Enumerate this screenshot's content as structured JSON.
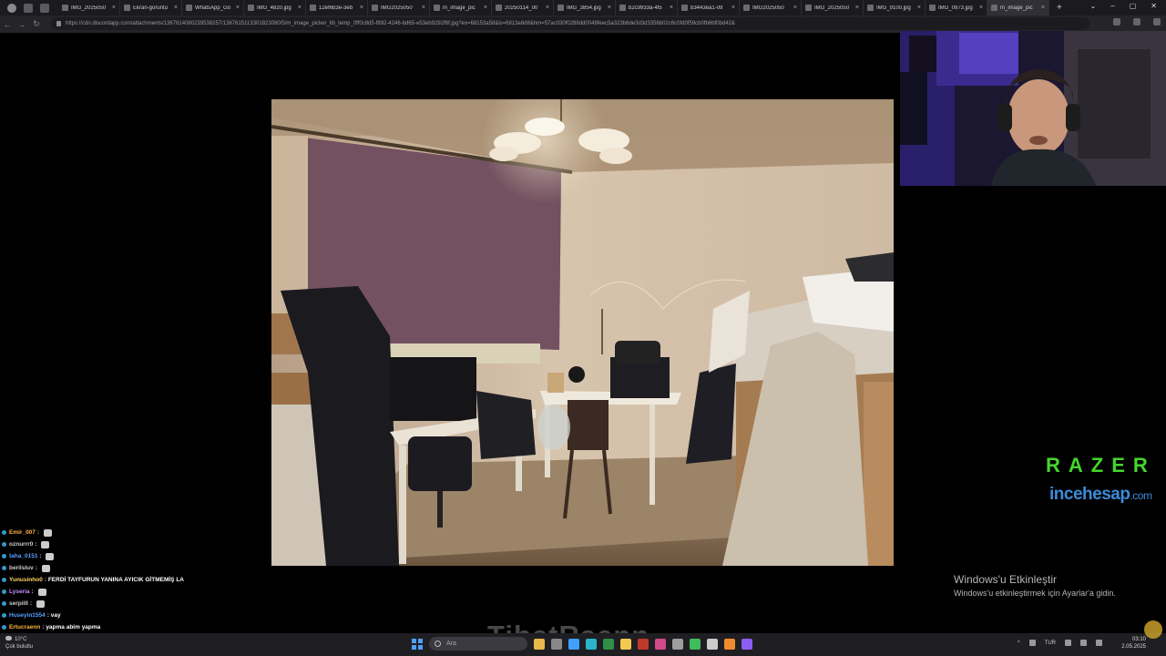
{
  "browser": {
    "tabs": [
      {
        "label": "IMG_2025050"
      },
      {
        "label": "Ekran-goruntu"
      },
      {
        "label": "WhatsApp_Gö"
      },
      {
        "label": "IMG_4820.jpg"
      },
      {
        "label": "12ef6b3e-3eb"
      },
      {
        "label": "IMG2025050"
      },
      {
        "label": "m_image_pic"
      },
      {
        "label": "20250114_00"
      },
      {
        "label": "IMG_3854.jpg"
      },
      {
        "label": "b2c9933a-4f5"
      },
      {
        "label": "b3443ea1-09"
      },
      {
        "label": "IMG2025050"
      },
      {
        "label": "IMG_2025050"
      },
      {
        "label": "IMG_9100.jpg"
      },
      {
        "label": "IMG_0973.jpg"
      },
      {
        "label": "m_image_pic",
        "active": true
      }
    ],
    "close_glyph": "×",
    "new_tab_glyph": "+",
    "window_controls": [
      "⌄",
      "–",
      "▢",
      "✕"
    ],
    "nav_glyphs": {
      "back": "←",
      "forward": "→",
      "reload": "↻"
    },
    "url": "https://cdn.discordapp.com/attachments/1367614080239538257/1367615113301823080/5/m_image_picker_lib_temp_0ff0c8d5-f892-4246-bd65-e53eb9292f6f.jpg?ex=68153a58&is=6813e8d8&hm=57ac030f0289dd0049feec5a323b6de3d3d3356b02c6c0fd0f59cb0fb6bf0bd42&"
  },
  "overlay": {
    "razer_logo": "RAZER",
    "sponsor_name": "incehesap",
    "sponsor_tld": ".com",
    "windows_activation_title": "Windows'u Etkinleştir",
    "windows_activation_sub": "Windows'u etkinleştirmek için Ayarlar'a gidin.",
    "watermark": "TibetRaenn"
  },
  "chat": {
    "messages": [
      {
        "user": "Emir_007",
        "text": "",
        "color": "#ffb347"
      },
      {
        "user": "oznurrr0",
        "text": "",
        "color": "#cfcfcf"
      },
      {
        "user": "taha_0151",
        "text": "",
        "color": "#5aa0ff"
      },
      {
        "user": "berilsluv",
        "text": "",
        "color": "#cfcfcf"
      },
      {
        "user": "Yunusinho0",
        "text": "FERDİ TAYFURUN YANINA AYICIK GİTMEMİŞ LA",
        "color": "#ffd966"
      },
      {
        "user": "Lyseria",
        "text": "",
        "color": "#c58cff"
      },
      {
        "user": "serpiill",
        "text": "",
        "color": "#cfcfcf"
      },
      {
        "user": "Huseyin1554",
        "text": "vay",
        "color": "#5aa0ff"
      },
      {
        "user": "Ertucraenn",
        "text": "yapma abim yapma",
        "color": "#ffb347"
      }
    ]
  },
  "taskbar": {
    "weather_temp": "10°C",
    "weather_desc": "Çok bulutlu",
    "search_placeholder": "Ara",
    "tray_lang": "TUR",
    "tray_chevron": "^",
    "time": "03:10",
    "date": "2.05.2025",
    "app_colors": [
      "#e8b84a",
      "#888888",
      "#3fa0ff",
      "#2ab3c9",
      "#2f8f46",
      "#f3c94e",
      "#c0392b",
      "#d14a8b",
      "#9e9e9e",
      "#3ebd5a",
      "#cccccc",
      "#f08c2e",
      "#8b5cf6"
    ]
  }
}
